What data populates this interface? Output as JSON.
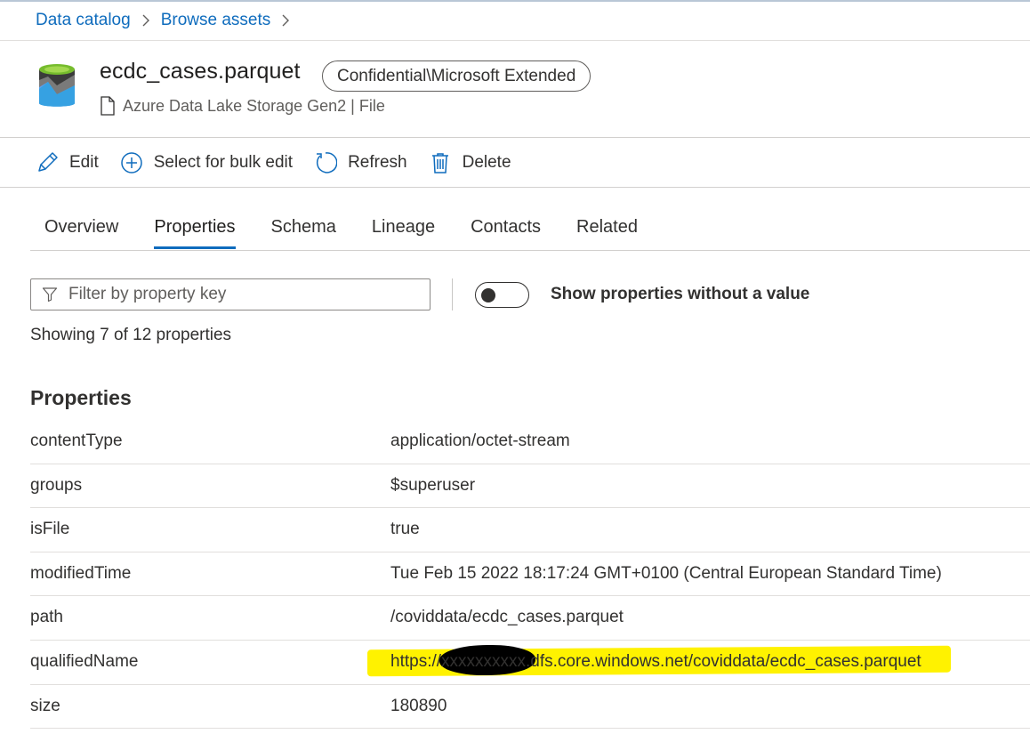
{
  "breadcrumb": {
    "items": [
      {
        "label": "Data catalog"
      },
      {
        "label": "Browse assets"
      }
    ]
  },
  "asset": {
    "title": "ecdc_cases.parquet",
    "sensitivity_label": "Confidential\\Microsoft Extended",
    "subtitle": "Azure Data Lake Storage Gen2 | File",
    "icon": "data-lake-storage-icon"
  },
  "toolbar": {
    "edit_label": "Edit",
    "bulk_label": "Select for bulk edit",
    "refresh_label": "Refresh",
    "delete_label": "Delete"
  },
  "tabs": [
    {
      "label": "Overview",
      "active": false
    },
    {
      "label": "Properties",
      "active": true
    },
    {
      "label": "Schema",
      "active": false
    },
    {
      "label": "Lineage",
      "active": false
    },
    {
      "label": "Contacts",
      "active": false
    },
    {
      "label": "Related",
      "active": false
    }
  ],
  "filter": {
    "placeholder": "Filter by property key",
    "value": ""
  },
  "toggle": {
    "label": "Show properties without a value",
    "on": false
  },
  "showing_text": "Showing 7 of 12 properties",
  "section_title": "Properties",
  "properties": [
    {
      "key": "contentType",
      "value": "application/octet-stream"
    },
    {
      "key": "groups",
      "value": "$superuser"
    },
    {
      "key": "isFile",
      "value": "true"
    },
    {
      "key": "modifiedTime",
      "value": "Tue Feb 15 2022 18:17:24 GMT+0100 (Central European Standard Time)"
    },
    {
      "key": "path",
      "value": "/coviddata/ecdc_cases.parquet"
    },
    {
      "key": "qualifiedName",
      "value": "https://xxxxxxxxxx.dfs.core.windows.net/coviddata/ecdc_cases.parquet"
    },
    {
      "key": "size",
      "value": "180890"
    }
  ],
  "colors": {
    "link": "#0f6cbd",
    "tab_underline": "#0f6cbd",
    "highlight": "#fff200"
  }
}
